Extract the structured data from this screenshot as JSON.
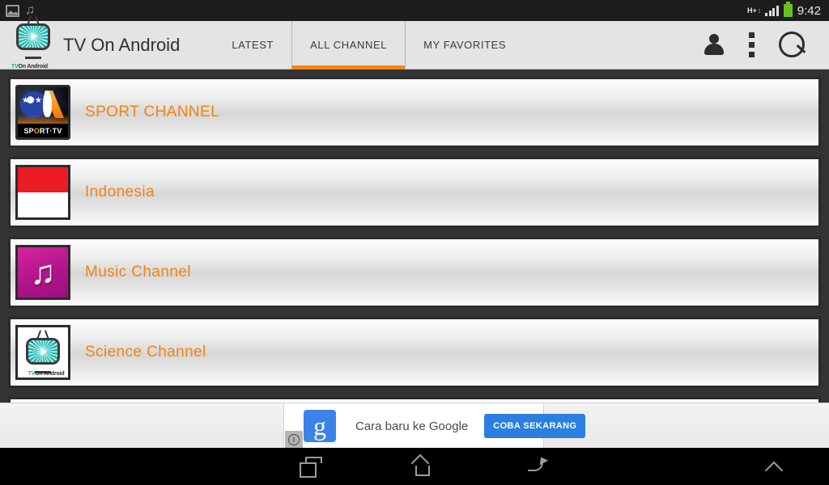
{
  "status_bar": {
    "left_icons": [
      "gallery-icon",
      "music-note-icon"
    ],
    "network_type": "H+",
    "network_arrows": "↕",
    "signal_icon": "signal-bars-icon",
    "battery_icon": "battery-icon",
    "clock": "9:42"
  },
  "action_bar": {
    "logo_icon": "tv-on-android-logo",
    "logo_caption_1": "TV",
    "logo_caption_2": "On Android",
    "title": "TV On Android",
    "tabs": [
      {
        "label": "LATEST",
        "active": false
      },
      {
        "label": "ALL CHANNEL",
        "active": true
      },
      {
        "label": "MY FAVORITES",
        "active": false
      }
    ],
    "actions": [
      {
        "name": "account-icon"
      },
      {
        "name": "overflow-menu-icon"
      },
      {
        "name": "search-icon"
      }
    ],
    "accent_color": "#f58410"
  },
  "channels": [
    {
      "label": "SPORT CHANNEL",
      "thumb": "sport-tv-thumb",
      "thumb_caption_a": "SP",
      "thumb_caption_b": "O",
      "thumb_caption_c": "RT·TV"
    },
    {
      "label": "Indonesia",
      "thumb": "indonesia-flag-thumb"
    },
    {
      "label": "Music Channel",
      "thumb": "music-note-thumb",
      "glyph": "♫"
    },
    {
      "label": "Science Channel",
      "thumb": "tv-on-android-thumb",
      "caption_1": "TV",
      "caption_2": "On Android"
    }
  ],
  "ad": {
    "logo_letter": "g",
    "text": "Cara baru ke Google",
    "cta": "COBA SEKARANG",
    "adchoices_glyph": "i",
    "cta_color": "#2a7fe0"
  },
  "nav_bar": {
    "buttons": [
      {
        "name": "recents-icon"
      },
      {
        "name": "home-icon"
      },
      {
        "name": "back-icon"
      },
      {
        "name": "expand-chevron-icon"
      }
    ]
  }
}
